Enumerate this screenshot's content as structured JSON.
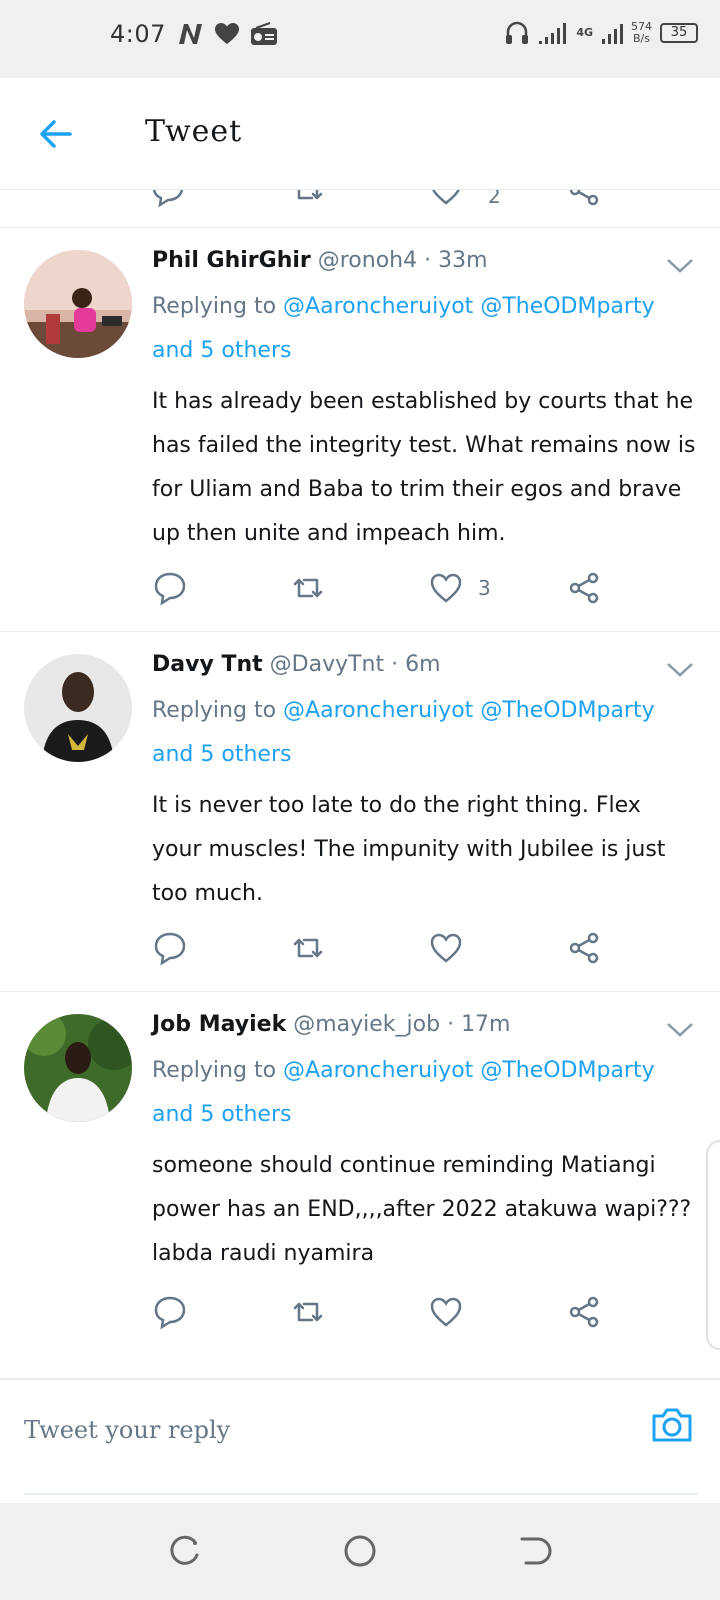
{
  "status_bar": {
    "time": "4:07",
    "network": "4G",
    "speed_value": "574",
    "speed_unit": "B/s",
    "battery": "35"
  },
  "header": {
    "title": "Tweet"
  },
  "partial_tweet": {
    "like_count": "2"
  },
  "tweets": [
    {
      "name": "Phil GhirGhir",
      "handle": "@ronoh4",
      "separator": "·",
      "time": "33m",
      "replying_prefix": "Replying to",
      "reply_to_1": "@Aaroncheruiyot",
      "reply_to_2": "@TheODMparty",
      "and_others": "and 5 others",
      "text": "It has already been established by courts that he has failed the integrity test. What remains now is for Uliam and Baba to trim their egos and brave up then unite and impeach him.",
      "like_count": "3"
    },
    {
      "name": "Davy Tnt",
      "handle": "@DavyTnt",
      "separator": "·",
      "time": "6m",
      "replying_prefix": "Replying to",
      "reply_to_1": "@Aaroncheruiyot",
      "reply_to_2": "@TheODMparty",
      "and_others": "and 5 others",
      "text": "It is never too late to do the right thing. Flex your muscles! The impunity with Jubilee is  just too much.",
      "like_count": ""
    },
    {
      "name": "Job Mayiek",
      "handle": "@mayiek_job",
      "separator": "·",
      "time": "17m",
      "replying_prefix": "Replying to",
      "reply_to_1": "@Aaroncheruiyot",
      "reply_to_2": "@TheODMparty",
      "and_others": "and 5 others",
      "text": "someone should continue reminding Matiangi power has an END,,,,after 2022 atakuwa wapi???labda raudi nyamira",
      "like_count": ""
    }
  ],
  "reply_bar": {
    "placeholder": "Tweet your reply"
  },
  "icons": {
    "accent": "#1da1f2",
    "muted": "#657786",
    "back": "arrow-left-icon",
    "reply": "comment-icon",
    "retweet": "retweet-icon",
    "like": "heart-icon",
    "share": "share-icon",
    "camera": "camera-icon"
  }
}
